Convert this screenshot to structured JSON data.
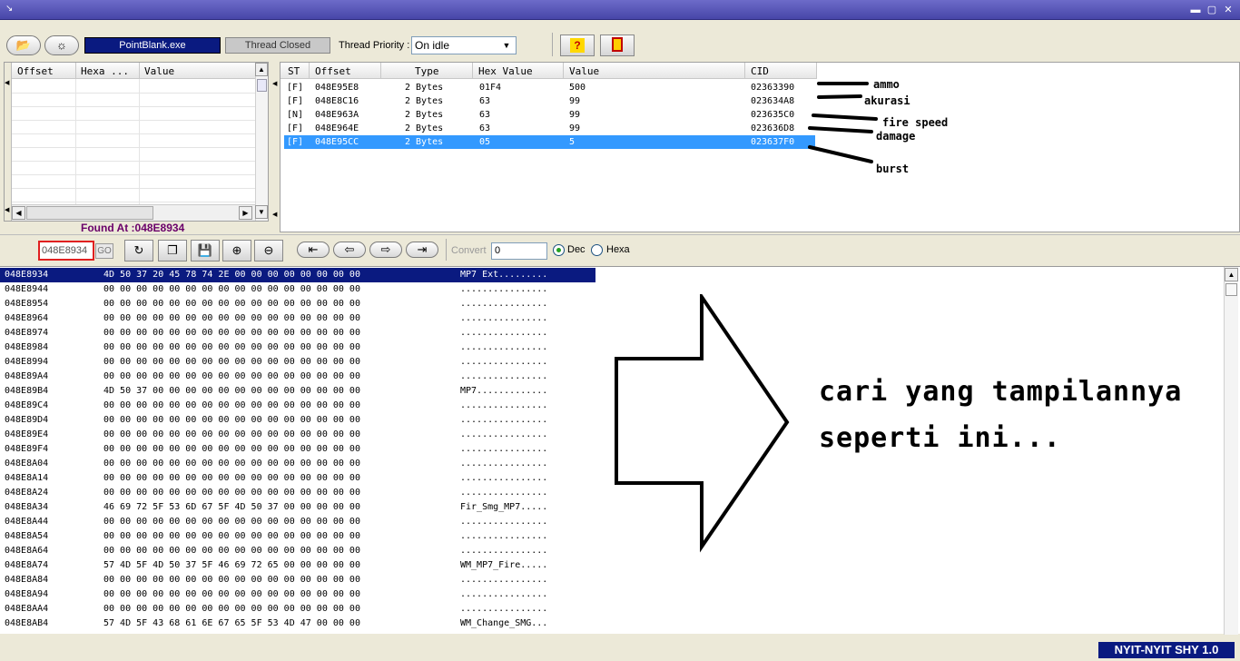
{
  "toolbar": {
    "process_name": "PointBlank.exe",
    "thread_status": "Thread Closed",
    "thread_priority_label": "Thread Priority :",
    "thread_priority_value": "On idle"
  },
  "left_panel": {
    "columns": [
      "Offset",
      "Hexa ...",
      "Value"
    ],
    "found_at": "Found At :048E8934"
  },
  "results": {
    "columns": [
      "ST",
      "Offset",
      "Type",
      "Hex Value",
      "Value",
      "CID"
    ],
    "rows": [
      {
        "st": "[F]",
        "offset": "048E95E8",
        "type": "2 Bytes",
        "hex": "01F4",
        "value": "500",
        "cid": "02363390"
      },
      {
        "st": "[F]",
        "offset": "048E8C16",
        "type": "2 Bytes",
        "hex": "63",
        "value": "99",
        "cid": "023634A8"
      },
      {
        "st": "[N]",
        "offset": "048E963A",
        "type": "2 Bytes",
        "hex": "63",
        "value": "99",
        "cid": "023635C0"
      },
      {
        "st": "[F]",
        "offset": "048E964E",
        "type": "2 Bytes",
        "hex": "63",
        "value": "99",
        "cid": "023636D8"
      },
      {
        "st": "[F]",
        "offset": "048E95CC",
        "type": "2 Bytes",
        "hex": "05",
        "value": "5",
        "cid": "023637F0"
      }
    ],
    "selected_index": 4
  },
  "annotations": {
    "ammo": "ammo",
    "akurasi": "akurasi",
    "fire_speed": "fire speed",
    "damage": "damage",
    "burst": "burst",
    "line1": "cari yang tampilannya",
    "line2": "seperti ini..."
  },
  "hex_toolbar": {
    "address": "048E8934",
    "go": "GO",
    "convert_label": "Convert",
    "convert_value": "0",
    "dec_label": "Dec",
    "hexa_label": "Hexa",
    "dec_selected": true
  },
  "hex_rows": [
    {
      "addr": "048E8934",
      "bytes": "4D 50 37 20 45 78 74 2E 00 00 00 00 00 00 00 00",
      "ascii": "MP7 Ext........."
    },
    {
      "addr": "048E8944",
      "bytes": "00 00 00 00 00 00 00 00 00 00 00 00 00 00 00 00",
      "ascii": "................"
    },
    {
      "addr": "048E8954",
      "bytes": "00 00 00 00 00 00 00 00 00 00 00 00 00 00 00 00",
      "ascii": "................"
    },
    {
      "addr": "048E8964",
      "bytes": "00 00 00 00 00 00 00 00 00 00 00 00 00 00 00 00",
      "ascii": "................"
    },
    {
      "addr": "048E8974",
      "bytes": "00 00 00 00 00 00 00 00 00 00 00 00 00 00 00 00",
      "ascii": "................"
    },
    {
      "addr": "048E8984",
      "bytes": "00 00 00 00 00 00 00 00 00 00 00 00 00 00 00 00",
      "ascii": "................"
    },
    {
      "addr": "048E8994",
      "bytes": "00 00 00 00 00 00 00 00 00 00 00 00 00 00 00 00",
      "ascii": "................"
    },
    {
      "addr": "048E89A4",
      "bytes": "00 00 00 00 00 00 00 00 00 00 00 00 00 00 00 00",
      "ascii": "................"
    },
    {
      "addr": "048E89B4",
      "bytes": "4D 50 37 00 00 00 00 00 00 00 00 00 00 00 00 00",
      "ascii": "MP7............."
    },
    {
      "addr": "048E89C4",
      "bytes": "00 00 00 00 00 00 00 00 00 00 00 00 00 00 00 00",
      "ascii": "................"
    },
    {
      "addr": "048E89D4",
      "bytes": "00 00 00 00 00 00 00 00 00 00 00 00 00 00 00 00",
      "ascii": "................"
    },
    {
      "addr": "048E89E4",
      "bytes": "00 00 00 00 00 00 00 00 00 00 00 00 00 00 00 00",
      "ascii": "................"
    },
    {
      "addr": "048E89F4",
      "bytes": "00 00 00 00 00 00 00 00 00 00 00 00 00 00 00 00",
      "ascii": "................"
    },
    {
      "addr": "048E8A04",
      "bytes": "00 00 00 00 00 00 00 00 00 00 00 00 00 00 00 00",
      "ascii": "................"
    },
    {
      "addr": "048E8A14",
      "bytes": "00 00 00 00 00 00 00 00 00 00 00 00 00 00 00 00",
      "ascii": "................"
    },
    {
      "addr": "048E8A24",
      "bytes": "00 00 00 00 00 00 00 00 00 00 00 00 00 00 00 00",
      "ascii": "................"
    },
    {
      "addr": "048E8A34",
      "bytes": "46 69 72 5F 53 6D 67 5F 4D 50 37 00 00 00 00 00",
      "ascii": "Fir_Smg_MP7....."
    },
    {
      "addr": "048E8A44",
      "bytes": "00 00 00 00 00 00 00 00 00 00 00 00 00 00 00 00",
      "ascii": "................"
    },
    {
      "addr": "048E8A54",
      "bytes": "00 00 00 00 00 00 00 00 00 00 00 00 00 00 00 00",
      "ascii": "................"
    },
    {
      "addr": "048E8A64",
      "bytes": "00 00 00 00 00 00 00 00 00 00 00 00 00 00 00 00",
      "ascii": "................"
    },
    {
      "addr": "048E8A74",
      "bytes": "57 4D 5F 4D 50 37 5F 46 69 72 65 00 00 00 00 00",
      "ascii": "WM_MP7_Fire....."
    },
    {
      "addr": "048E8A84",
      "bytes": "00 00 00 00 00 00 00 00 00 00 00 00 00 00 00 00",
      "ascii": "................"
    },
    {
      "addr": "048E8A94",
      "bytes": "00 00 00 00 00 00 00 00 00 00 00 00 00 00 00 00",
      "ascii": "................"
    },
    {
      "addr": "048E8AA4",
      "bytes": "00 00 00 00 00 00 00 00 00 00 00 00 00 00 00 00",
      "ascii": "................"
    },
    {
      "addr": "048E8AB4",
      "bytes": "57 4D 5F 43 68 61 6E 67 65 5F 53 4D 47 00 00 00",
      "ascii": "WM_Change_SMG..."
    }
  ],
  "selected_hex_row": 0,
  "status": {
    "app_name": "NYIT-NYIT SHY 1.0"
  },
  "icons": {
    "open": "folder-open-icon",
    "settings": "gear-sun-icon",
    "help": "help-icon",
    "exit": "exit-door-icon"
  },
  "colors": {
    "title_bar": "#4f4eb3",
    "process_field": "#0a1a80",
    "selection": "#3399ff",
    "hex_selection": "#0a1a80",
    "found_at_text": "#6a006a",
    "address_border": "#e02020"
  }
}
